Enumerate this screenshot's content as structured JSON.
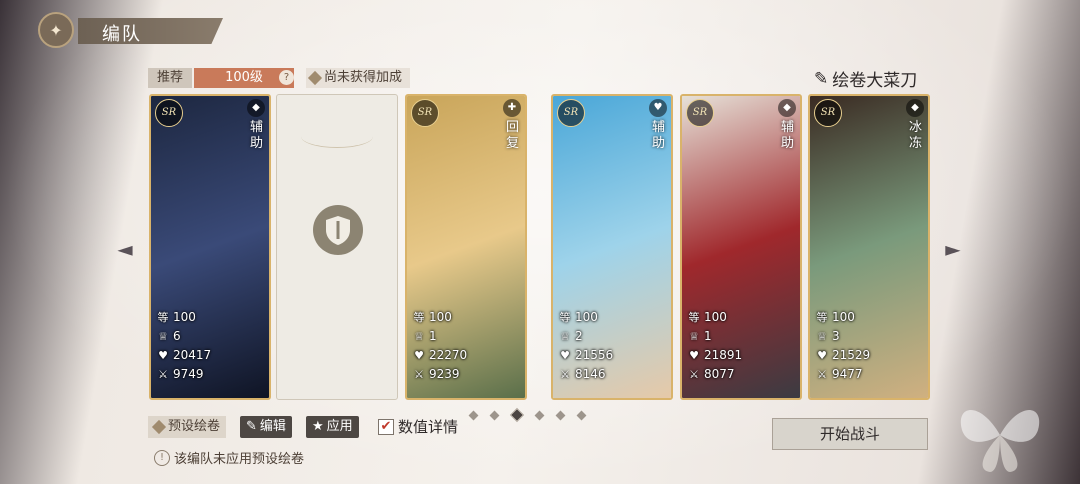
{
  "header": {
    "title": "编队",
    "back_icon": "butterfly-icon"
  },
  "recommend": {
    "label": "推荐",
    "value": "100级",
    "help": "?"
  },
  "bonus": {
    "label": "尚未获得加成"
  },
  "team_name": "绘卷大菜刀",
  "cards": [
    {
      "rarity": "SR",
      "role": "辅助",
      "level": "100",
      "stars": "6",
      "hp": "20417",
      "atk": "9749",
      "colors": [
        "#1d2740",
        "#3a4a78",
        "#0f1424"
      ]
    },
    {
      "rarity": "SR",
      "role": "回复",
      "level": "100",
      "stars": "1",
      "hp": "22270",
      "atk": "9239",
      "colors": [
        "#c9a55a",
        "#e8c98a",
        "#5a6f4a"
      ]
    },
    {
      "rarity": "SR",
      "role": "辅助",
      "level": "100",
      "stars": "2",
      "hp": "21556",
      "atk": "8146",
      "colors": [
        "#4aa7d8",
        "#9ed3ea",
        "#e6c9a8"
      ]
    },
    {
      "rarity": "SR",
      "role": "辅助",
      "level": "100",
      "stars": "1",
      "hp": "21891",
      "atk": "8077",
      "colors": [
        "#e6e1d8",
        "#a0282c",
        "#3b3b42"
      ]
    },
    {
      "rarity": "SR",
      "role": "冰冻",
      "level": "100",
      "stars": "3",
      "hp": "21529",
      "atk": "9477",
      "colors": [
        "#3a2a22",
        "#7a9a7c",
        "#d0b080"
      ]
    }
  ],
  "stat_labels": {
    "level_prefix": "等级"
  },
  "preset": {
    "label": "预设绘卷",
    "edit": "编辑",
    "apply": "应用"
  },
  "details": {
    "label": "数值详情",
    "checked": true
  },
  "pagination": {
    "count": 6,
    "active": 3
  },
  "start_button": "开始战斗",
  "notice": "该编队未应用预设绘卷",
  "nav": {
    "prev": "◄",
    "next": "►"
  },
  "colors": {
    "accent": "#c97a5a",
    "frame": "#d9b36a"
  }
}
